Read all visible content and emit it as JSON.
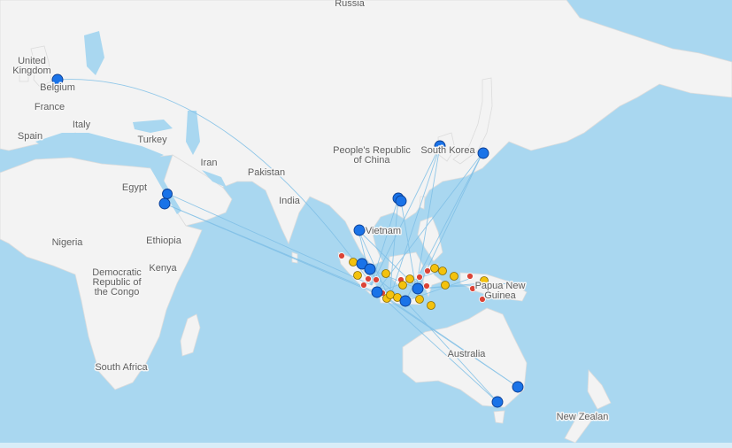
{
  "map": {
    "labels": {
      "russia": "Russia",
      "united_kingdom": "United\nKingdom",
      "belgium": "Belgium",
      "france": "France",
      "spain": "Spain",
      "italy": "Italy",
      "turkey": "Turkey",
      "iran": "Iran",
      "egypt": "Egypt",
      "pakistan": "Pakistan",
      "india": "India",
      "china": "People's Republic\nof China",
      "south_korea": "South Korea",
      "vietnam": "Vietnam",
      "nigeria": "Nigeria",
      "ethiopia": "Ethiopia",
      "kenya": "Kenya",
      "drc": "Democratic\nRepublic of\nthe Congo",
      "south_africa": "South Africa",
      "australia": "Australia",
      "papua_new_guinea": "Papua New\nGuinea",
      "new_zealand": "New Zealan"
    },
    "colors": {
      "water": "#a9d7f0",
      "land": "#f3f3f3",
      "route": "#7fbfe6",
      "hub_marker": "#1a73e8",
      "yellow_marker": "#f4c20d",
      "red_marker": "#db4437"
    },
    "marker_types": {
      "hub": "blue",
      "site": "yellow",
      "minor": "red"
    }
  }
}
